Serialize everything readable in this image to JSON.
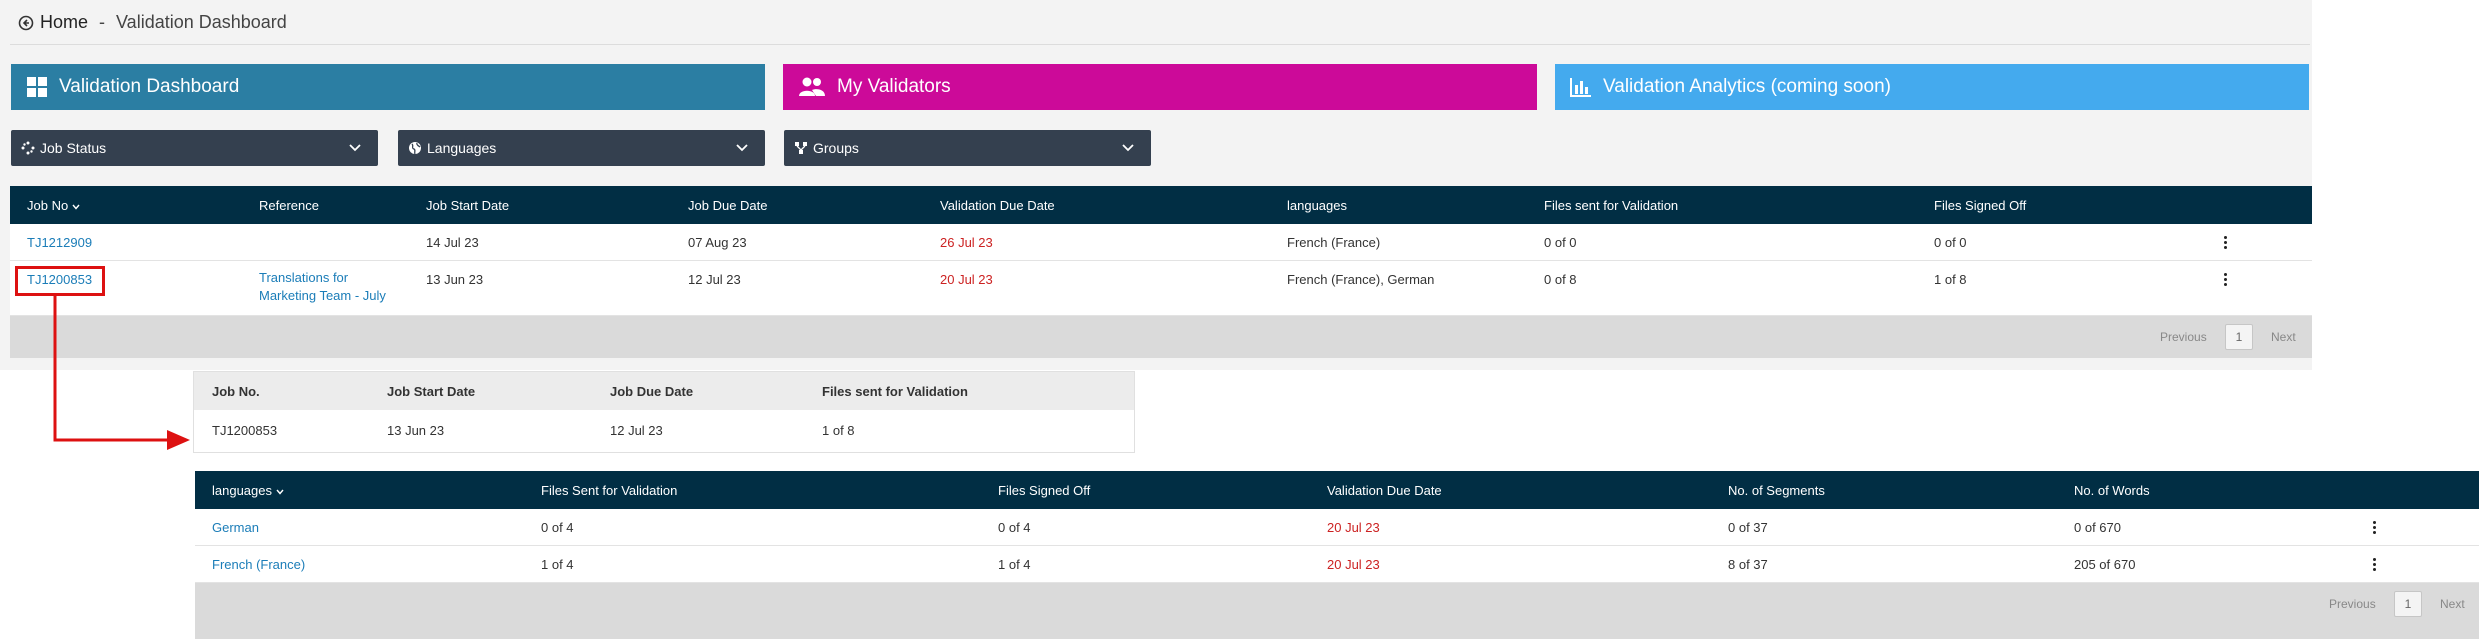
{
  "header": {
    "home_label": "Home",
    "separator": " - ",
    "page_title": "Validation Dashboard"
  },
  "tiles": [
    {
      "label": "Validation Dashboard",
      "color": "#2b7ea3",
      "icon": "dashboard-icon"
    },
    {
      "label": "My Validators",
      "color": "#cc0a99",
      "icon": "users-icon"
    },
    {
      "label": "Validation Analytics (coming soon)",
      "color": "#44aaee",
      "icon": "bar-chart-icon"
    }
  ],
  "filters": [
    {
      "label": "Job Status",
      "icon": "spinner-icon"
    },
    {
      "label": "Languages",
      "icon": "globe-icon"
    },
    {
      "label": "Groups",
      "icon": "sitemap-icon"
    }
  ],
  "jobs_table": {
    "headers": [
      "Job No",
      "Reference",
      "Job Start Date",
      "Job Due Date",
      "Validation Due Date",
      "languages",
      "Files sent for Validation",
      "Files Signed Off"
    ],
    "rows": [
      {
        "job_no": "TJ1212909",
        "reference": "",
        "start": "14 Jul 23",
        "due": "07 Aug 23",
        "validation_due": "26 Jul 23",
        "languages": "French (France)",
        "files_sent": "0 of 0",
        "signed_off": "0 of 0"
      },
      {
        "job_no": "TJ1200853",
        "reference": "Translations for Marketing Team - July",
        "start": "13 Jun 23",
        "due": "12 Jul 23",
        "validation_due": "20 Jul 23",
        "languages": "French (France), German",
        "files_sent": "0 of 8",
        "signed_off": "1 of 8"
      }
    ],
    "pager": {
      "previous": "Previous",
      "page": "1",
      "next": "Next"
    }
  },
  "job_detail": {
    "headers": [
      "Job No.",
      "Job Start Date",
      "Job Due Date",
      "Files sent for Validation"
    ],
    "row": {
      "job_no": "TJ1200853",
      "start": "13 Jun 23",
      "due": "12 Jul 23",
      "files_sent": "1 of 8"
    }
  },
  "language_table": {
    "headers": [
      "languages",
      "Files Sent for Validation",
      "Files Signed Off",
      "Validation Due Date",
      "No. of Segments",
      "No. of Words"
    ],
    "rows": [
      {
        "language": "German",
        "files_sent": "0 of 4",
        "signed_off": "0 of 4",
        "validation_due": "20 Jul 23",
        "segments": "0 of 37",
        "words": "0 of 670"
      },
      {
        "language": "French (France)",
        "files_sent": "1 of 4",
        "signed_off": "1 of 4",
        "validation_due": "20 Jul 23",
        "segments": "8 of 37",
        "words": "205 of 670"
      }
    ],
    "pager": {
      "previous": "Previous",
      "page": "1",
      "next": "Next"
    }
  },
  "colors": {
    "header_bg": "#012e44",
    "filter_bg": "#34404f",
    "link": "#1b7db8",
    "overdue": "#cc2222",
    "annotation": "#dd1111"
  }
}
